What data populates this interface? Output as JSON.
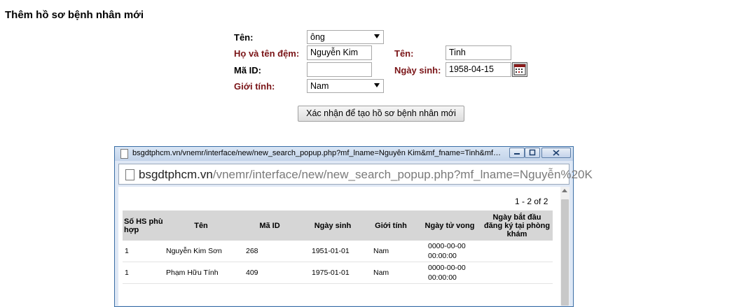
{
  "page_title": "Thêm hồ sơ bệnh nhân mới",
  "form": {
    "title_label": "Tên:",
    "title_value": "ông",
    "lastname_label": "Họ và tên đệm:",
    "lastname_value": "Nguyễn Kim",
    "firstname_label": "Tên:",
    "firstname_value": "Tinh",
    "id_label": "Mã ID:",
    "id_value": "",
    "dob_label": "Ngày sinh:",
    "dob_value": "1958-04-15",
    "sex_label": "Giới tính:",
    "sex_value": "Nam",
    "submit_label": "Xác nhận để tạo hồ sơ bệnh nhân mới"
  },
  "popup": {
    "title": "bsgdtphcm.vn/vnemr/interface/new/new_search_popup.php?mf_lname=Nguyễn Kim&mf_fname=Tinh&mf_...",
    "url_host": "bsgdtphcm.vn",
    "url_path": "/vnemr/interface/new/new_search_popup.php?mf_lname=Nguyễn%20K",
    "pager": "1 - 2 of 2",
    "columns": [
      "Số HS phù hợp",
      "Tên",
      "Mã ID",
      "Ngày sinh",
      "Giới tính",
      "Ngày tử vong",
      "Ngày bắt đầu đăng ký tại phòng khám"
    ],
    "rows": [
      [
        "1",
        "Nguyễn Kim Sơn",
        "268",
        "1951-01-01",
        "Nam",
        "0000-00-00 00:00:00",
        ""
      ],
      [
        "1",
        "Phạm Hữu Tính",
        "409",
        "1975-01-01",
        "Nam",
        "0000-00-00 00:00:00",
        ""
      ]
    ]
  }
}
